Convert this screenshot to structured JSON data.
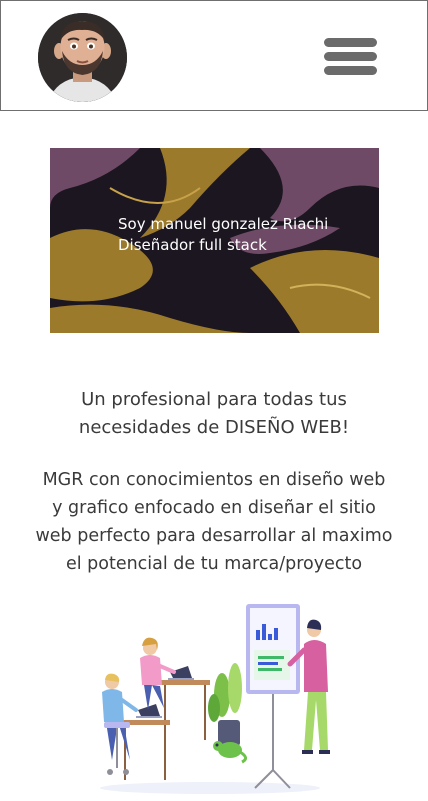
{
  "header": {
    "avatar_icon": "profile-avatar",
    "menu_icon": "hamburger-menu-icon"
  },
  "hero": {
    "line1": "Soy manuel gonzalez Riachi",
    "line2": "Diseñador full stack",
    "colors": {
      "gold": "#9c7a2c",
      "dark": "#1b1620",
      "purple": "#6f4a66"
    }
  },
  "tagline": {
    "line1": "Un profesional para todas tus",
    "line2": "necesidades de DISEÑO WEB!"
  },
  "description": {
    "line1": "MGR con conocimientos en diseño web",
    "line2": "y grafico enfocado en diseñar el sitio",
    "line3": "web perfecto para desarrollar al maximo",
    "line4": "el potencial de tu marca/proyecto"
  },
  "illustration": {
    "icon": "team-working-illustration"
  }
}
